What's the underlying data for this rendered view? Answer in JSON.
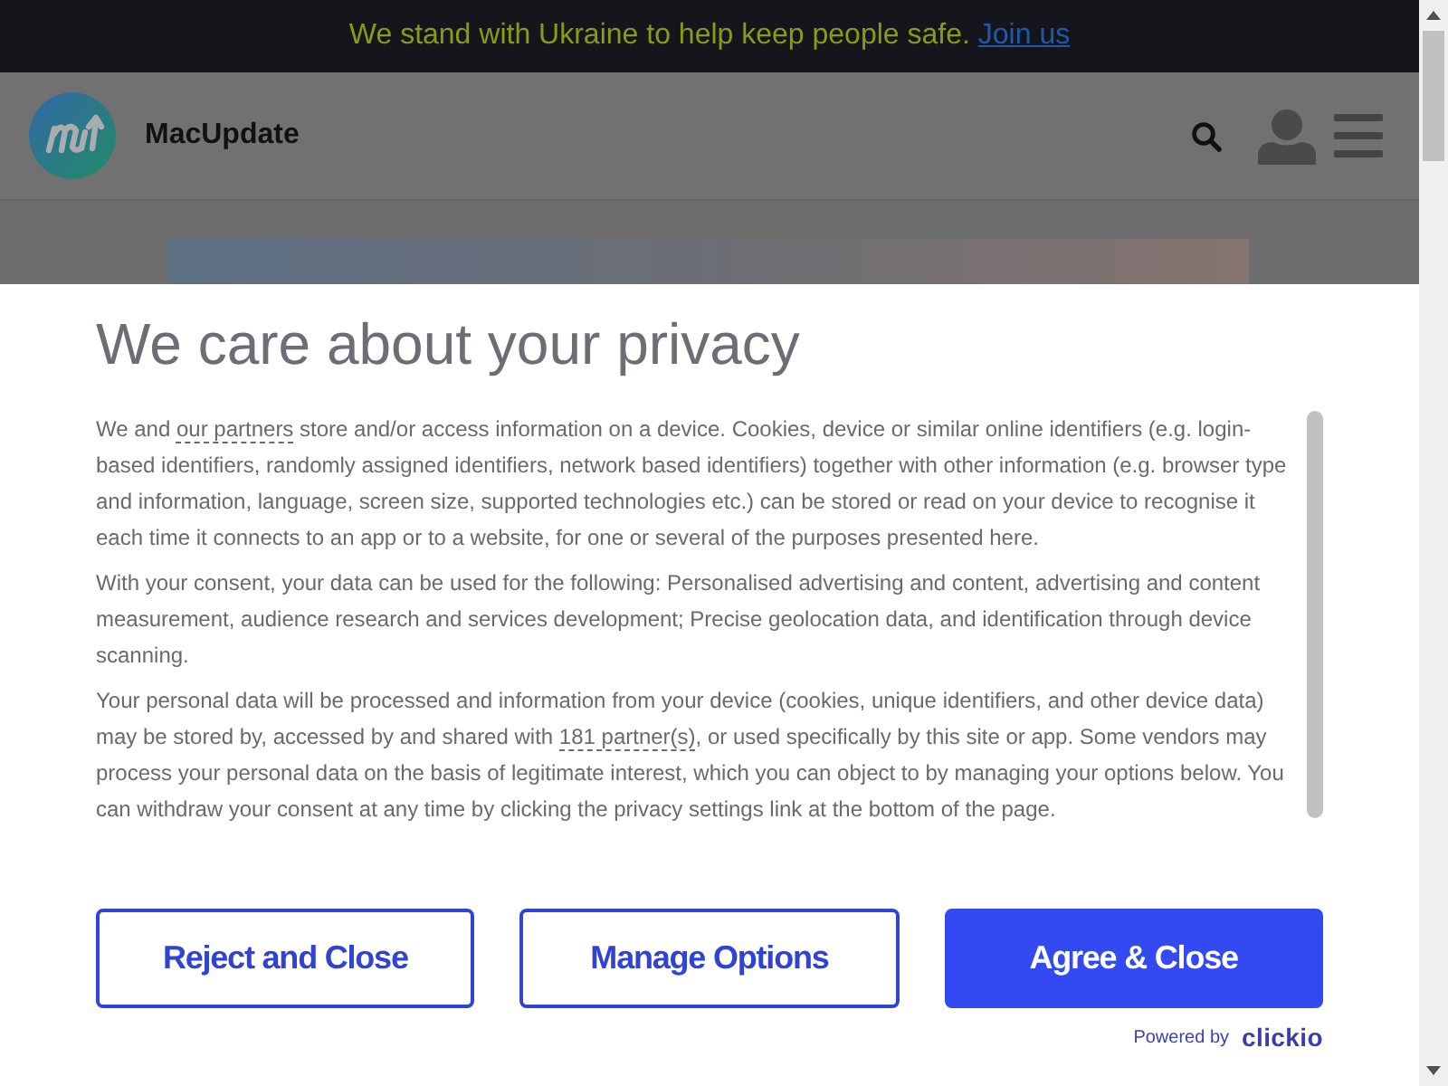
{
  "banner": {
    "text": "We stand with Ukraine to help keep people safe.",
    "link": "Join us"
  },
  "header": {
    "site_name": "MacUpdate"
  },
  "consent": {
    "title": "We care about your privacy",
    "paragraphs": [
      [
        {
          "kind": "text",
          "text": "We and "
        },
        {
          "kind": "link",
          "text": "our partners"
        },
        {
          "kind": "text",
          "text": " store and/or access information on a device. Cookies, device or similar online identifiers (e.g. login-based identifiers, randomly assigned identifiers, network based identifiers) together with other information (e.g. browser type and information, language, screen size, supported technologies etc.) can be stored or read on your device to recognise it each time it connects to an app or to a website, for one or several of the purposes presented here."
        }
      ],
      [
        {
          "kind": "text",
          "text": "With your consent, your data can be used for the following: Personalised advertising and content, advertising and content measurement, audience research and services development; Precise geolocation data, and identification through device scanning."
        }
      ],
      [
        {
          "kind": "text",
          "text": "Your personal data will be processed and information from your device (cookies, unique identifiers, and other device data) may be stored by, accessed by and shared with "
        },
        {
          "kind": "link",
          "text": "181 partner(s)"
        },
        {
          "kind": "text",
          "text": ", or used specifically by this site or app. Some vendors may process your personal data on the basis of legitimate interest, which you can object to by managing your options below. You can withdraw your consent at any time by clicking the privacy settings link at the bottom of the page."
        }
      ]
    ],
    "buttons": [
      {
        "label": "Reject and Close",
        "kind": "outline"
      },
      {
        "label": "Manage Options",
        "kind": "outline"
      },
      {
        "label": "Agree & Close",
        "kind": "filled"
      }
    ],
    "powered_by": {
      "label": "Powered by",
      "brand": "clickio"
    }
  }
}
